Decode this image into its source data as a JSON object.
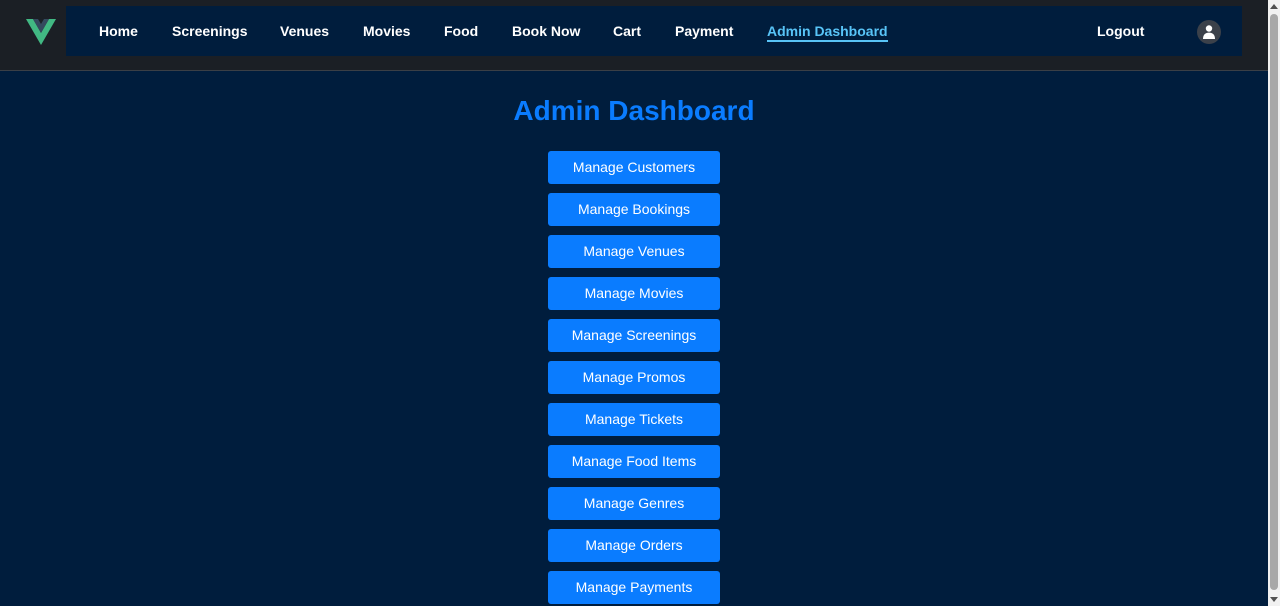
{
  "nav": {
    "logo_icon": "vue-logo-icon",
    "items": [
      {
        "label": "Home"
      },
      {
        "label": "Screenings"
      },
      {
        "label": "Venues"
      },
      {
        "label": "Movies"
      },
      {
        "label": "Food"
      },
      {
        "label": "Book Now"
      },
      {
        "label": "Cart"
      },
      {
        "label": "Payment"
      },
      {
        "label": "Admin Dashboard",
        "active": true
      }
    ],
    "logout_label": "Logout",
    "avatar_icon": "user-icon"
  },
  "main": {
    "title": "Admin Dashboard",
    "buttons": [
      {
        "label": "Manage Customers"
      },
      {
        "label": "Manage Bookings"
      },
      {
        "label": "Manage Venues"
      },
      {
        "label": "Manage Movies"
      },
      {
        "label": "Manage Screenings"
      },
      {
        "label": "Manage Promos"
      },
      {
        "label": "Manage Tickets"
      },
      {
        "label": "Manage Food Items"
      },
      {
        "label": "Manage Genres"
      },
      {
        "label": "Manage Orders"
      },
      {
        "label": "Manage Payments"
      }
    ]
  },
  "colors": {
    "background": "#001d3d",
    "accent": "#0a7cff",
    "active_link": "#58c4f7",
    "logo_green": "#41b883",
    "logo_dark": "#34495e"
  }
}
